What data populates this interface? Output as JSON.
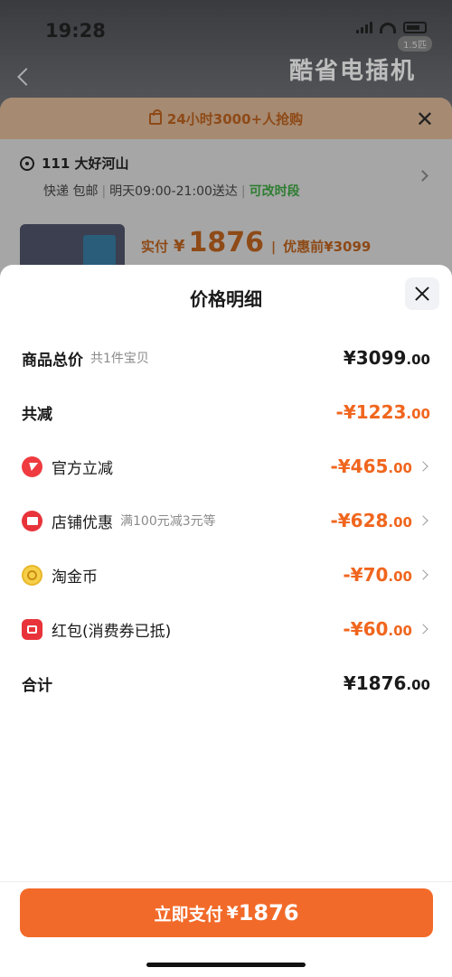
{
  "status_bar": {
    "time": "19:28"
  },
  "background": {
    "product_title": "酷省电插机",
    "badge": "1.5匹",
    "promo_text": "24小时3000+人抢购",
    "address_label": "111 大好河山",
    "delivery": {
      "type": "快递",
      "fee": "包邮",
      "time": "明天09:00-21:00送达",
      "changeable": "可改时段"
    },
    "price": {
      "label": "实付",
      "currency": "¥",
      "value": "1876",
      "original_label": "优惠前",
      "original": "¥3099"
    }
  },
  "sheet": {
    "title": "价格明细",
    "rows": [
      {
        "name": "商品总价",
        "sub": "共1件宝贝",
        "amount": "¥3099",
        "decimal": ".00"
      },
      {
        "name": "共减",
        "amount": "-¥1223",
        "decimal": ".00"
      },
      {
        "name": "官方立减",
        "amount": "-¥465",
        "decimal": ".00"
      },
      {
        "name": "店铺优惠",
        "sub": "满100元减3元等",
        "amount": "-¥628",
        "decimal": ".00"
      },
      {
        "name": "淘金币",
        "amount": "-¥70",
        "decimal": ".00"
      },
      {
        "name": "红包(消费券已抵)",
        "amount": "-¥60",
        "decimal": ".00"
      },
      {
        "name": "合计",
        "amount": "¥1876",
        "decimal": ".00"
      }
    ],
    "pay_button": {
      "label": "立即支付",
      "currency": "¥",
      "amount": "1876"
    }
  },
  "colors": {
    "accent": "#f26a29",
    "discount": "#f0661e",
    "text": "#1a1a1a",
    "muted": "#8a8a8a"
  }
}
